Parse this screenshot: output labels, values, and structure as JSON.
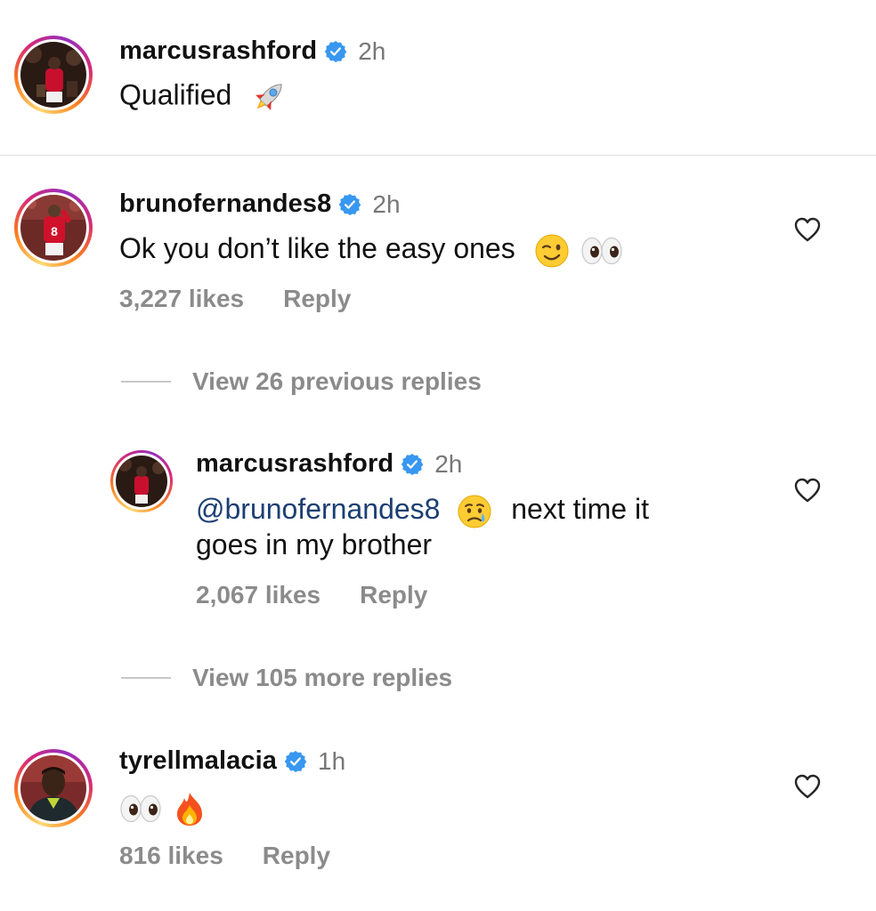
{
  "caption": {
    "username": "marcusrashford",
    "time": "2h",
    "text": "Qualified",
    "emoji": "rocket"
  },
  "comments": [
    {
      "username": "brunofernandes8",
      "time": "2h",
      "text": "Ok you don’t like the easy ones",
      "emojis": [
        "winking-face",
        "eyes"
      ],
      "likes": "3,227 likes",
      "reply_label": "Reply"
    }
  ],
  "previous_replies": "View 26 previous replies",
  "reply": {
    "username": "marcusrashford",
    "time": "2h",
    "mention": "@brunofernandes8",
    "emoji": "crying-face",
    "text_line1": "next time it",
    "text_line2": "goes in my brother",
    "likes": "2,067 likes",
    "reply_label": "Reply"
  },
  "more_replies": "View 105 more replies",
  "comment2": {
    "username": "tyrellmalacia",
    "time": "1h",
    "emojis": [
      "eyes",
      "fire"
    ],
    "likes": "816 likes",
    "reply_label": "Reply"
  },
  "colors": {
    "verified": "#3897f0",
    "muted": "#8b8b8b",
    "mention": "#1b3f73"
  }
}
